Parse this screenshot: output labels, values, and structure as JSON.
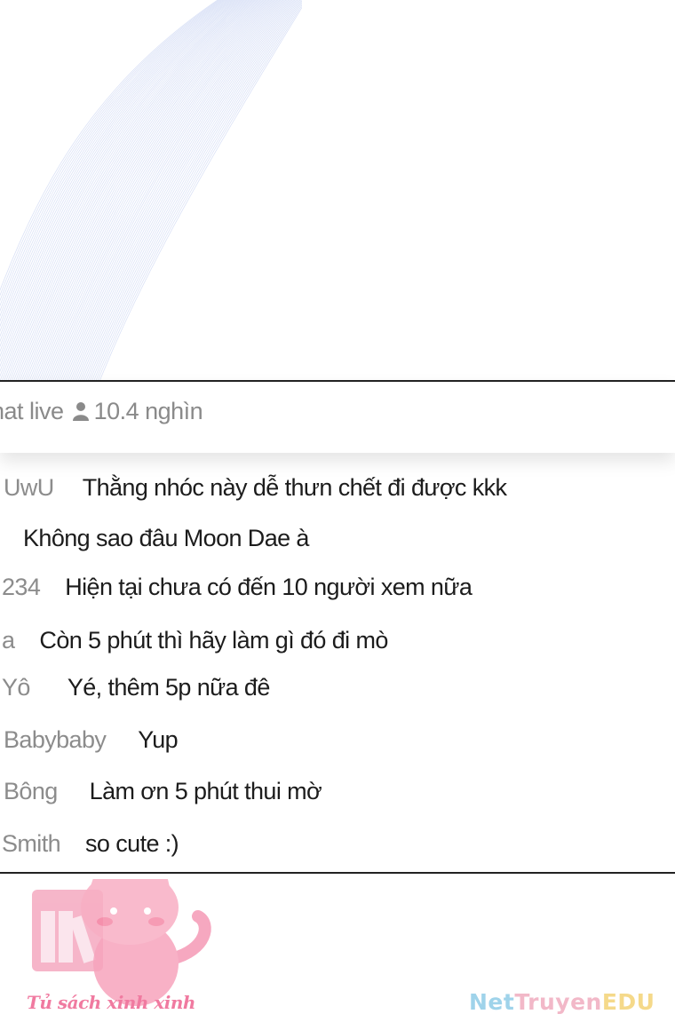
{
  "header": {
    "title_fragment": "hat live",
    "viewer_icon": "person-icon",
    "viewer_count": "10.4 nghìn"
  },
  "chat": [
    {
      "user": "UwU",
      "text": "Thằng nhóc này dễ thưn chết đi được kkk"
    },
    {
      "user": "",
      "text": "Không sao đâu Moon Dae à"
    },
    {
      "user": "234",
      "text": "Hiện tại chưa có đến 10 người xem nữa"
    },
    {
      "user": "a",
      "text": "Còn 5 phút thì hãy làm gì đó đi mò"
    },
    {
      "user": "Yô",
      "text": "Yé, thêm 5p nữa đê"
    },
    {
      "user": "Babybaby",
      "text": "Yup"
    },
    {
      "user": "Bông",
      "text": "Làm ơn 5 phút thui mờ"
    },
    {
      "user": "Smith",
      "text": "so cute :)"
    }
  ],
  "watermark": {
    "caption": "Tủ sách xinh xinh",
    "mascot_icon": "pink-cat-icon",
    "books_icon": "bookshelf-icon"
  },
  "brand": {
    "part1": "Net",
    "part2": "Truyen",
    "part3": "EDU"
  },
  "colors": {
    "username": "#8c8c8c",
    "message": "#1c1c1c",
    "wave": "#c9d4f2",
    "accent_pink": "#f07aa0"
  }
}
